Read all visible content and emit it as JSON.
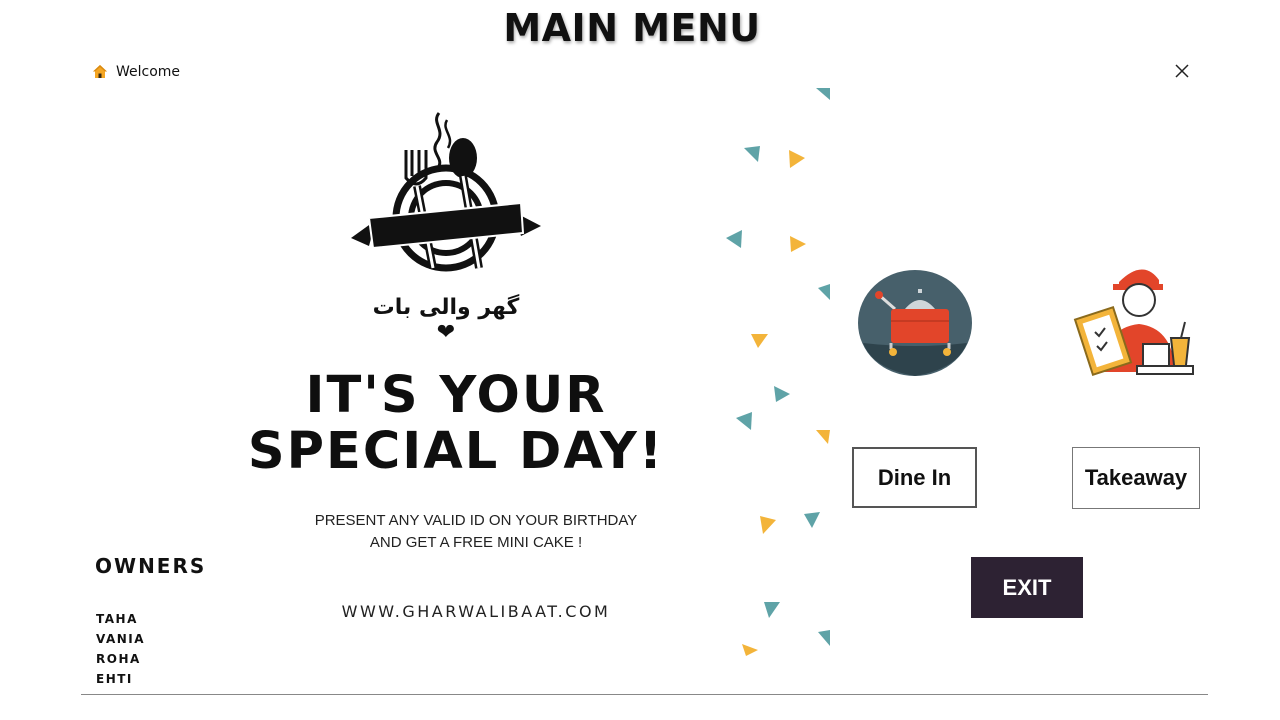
{
  "page_title": "MAIN MENU",
  "window": {
    "title": "Welcome",
    "home_icon": "home-icon",
    "close_icon": "close-icon"
  },
  "poster": {
    "logo_icon": "restaurant-logo-icon",
    "logo_text": "گھر والی بات ❤",
    "headline_line1": "IT'S YOUR",
    "headline_line2": "SPECIAL DAY!",
    "subtext_line1": "PRESENT ANY VALID ID ON YOUR BIRTHDAY",
    "subtext_line2": "AND GET A FREE MINI CAKE !",
    "website": "WWW.GHARWALIBAAT.COM",
    "owners_heading": "OWNERS",
    "owners": [
      "TAHA",
      "VANIA",
      "ROHA",
      "EHTI"
    ],
    "colors": {
      "teal": "#5fa3a7",
      "yellow": "#f3b43a"
    }
  },
  "menu": {
    "dine_in_icon": "dine-in-icon",
    "takeaway_icon": "takeaway-icon",
    "dine_in_label": "Dine In",
    "takeaway_label": "Takeaway",
    "exit_label": "EXIT",
    "exit_color": "#2d2233"
  }
}
